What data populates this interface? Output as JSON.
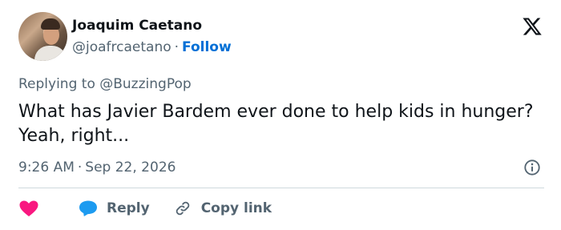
{
  "author": {
    "name": "Joaquim Caetano",
    "handle": "@joafrcaetano",
    "separator": "·",
    "follow_label": "Follow"
  },
  "reply_context": {
    "prefix": "Replying to",
    "mention": "@BuzzingPop"
  },
  "tweet": {
    "text": "What has Javier Bardem ever done to help kids in hunger? Yeah, right..."
  },
  "meta": {
    "time": "9:26 AM",
    "separator": "·",
    "date": "Sep 22, 2026"
  },
  "actions": {
    "like_icon": "heart-icon",
    "reply_label": "Reply",
    "copy_link_label": "Copy link"
  },
  "colors": {
    "accent": "#006fd6",
    "like": "#f91880",
    "reply": "#1d9bf0",
    "muted": "#536471",
    "text": "#0f1419",
    "divider": "#cfd9de"
  }
}
